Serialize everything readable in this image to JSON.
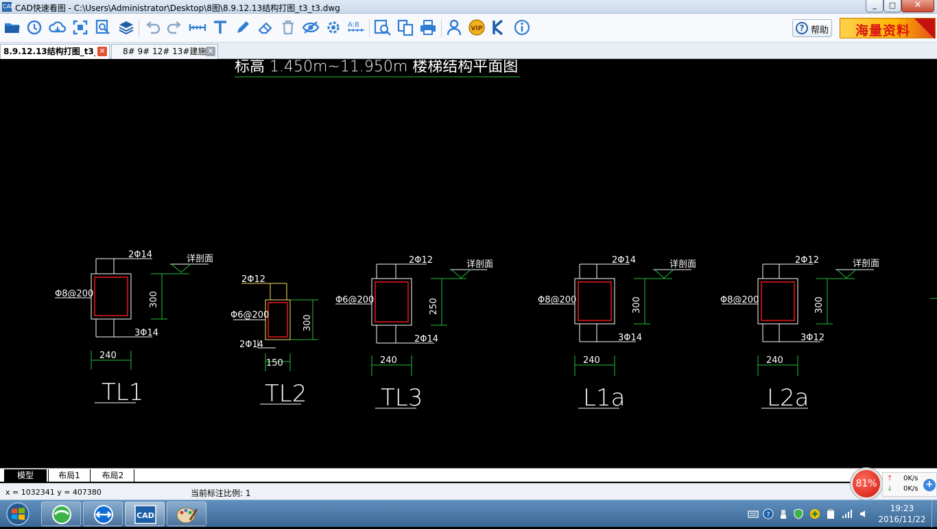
{
  "window": {
    "title": "CAD快速看图 - C:\\Users\\Administrator\\Desktop\\8图\\8.9.12.13结构打图_t3_t3.dwg",
    "app_icon_text": "CAD",
    "minimize": "_",
    "maximize": "□",
    "close": "✕"
  },
  "toolbar": {
    "icons": [
      "open-folder-icon",
      "history-icon",
      "cloud-icon",
      "fit-screen-icon",
      "zoom-window-icon",
      "layers-icon",
      "undo-icon",
      "redo-icon",
      "measure-icon",
      "text-icon",
      "pen-icon",
      "eraser-icon",
      "trash-icon",
      "hide-icon",
      "settings-icon",
      "scale-icon",
      "search-text-icon",
      "convert-icon",
      "print-icon",
      "user-icon",
      "vip-icon",
      "k-icon",
      "info-icon"
    ],
    "vip_label": "VIP",
    "scale_label": "A:B",
    "help_label": "帮助",
    "help_symbol": "?",
    "ad_text": "海量资料"
  },
  "tabs": [
    {
      "label": "8.9.12.13结构打图_t3_t3",
      "active": true
    },
    {
      "label": "8# 9# 12# 13#建施",
      "active": false
    }
  ],
  "tab_close_symbol": "✕",
  "drawing": {
    "header_text": "标高 1.450m~11.950m        楼梯结构平面图",
    "sections": [
      {
        "name": "TL1",
        "top_bar": "2Φ14",
        "bottom_bar": "3Φ14",
        "stirrup": "Φ8@200",
        "height": "300",
        "width": "240",
        "section_label": "详剖面"
      },
      {
        "name": "TL2",
        "top_bar": "2Φ12",
        "bottom_bar": "2Φ14",
        "stirrup": "Φ6@200",
        "height": "300",
        "width": "150",
        "section_label": ""
      },
      {
        "name": "TL3",
        "top_bar": "2Φ12",
        "bottom_bar": "2Φ14",
        "stirrup": "Φ6@200",
        "height": "250",
        "width": "240",
        "section_label": "详剖面"
      },
      {
        "name": "L1a",
        "top_bar": "2Φ14",
        "bottom_bar": "3Φ14",
        "stirrup": "Φ8@200",
        "height": "300",
        "width": "240",
        "section_label": "详剖面"
      },
      {
        "name": "L2a",
        "top_bar": "2Φ12",
        "bottom_bar": "3Φ12",
        "stirrup": "Φ8@200",
        "height": "300",
        "width": "240",
        "section_label": "详剖面"
      }
    ]
  },
  "layout_tabs": [
    "模型",
    "布局1",
    "布局2"
  ],
  "status": {
    "coords": "x = 1032341  y = 407380",
    "scale": "当前标注比例: 1"
  },
  "network": {
    "percent": "81%",
    "up": "0K/s",
    "down": "0K/s",
    "up_arrow": "↑",
    "down_arrow": "↓",
    "plus": "+"
  },
  "taskbar": {
    "apps": [
      "360-browser-icon",
      "teamviewer-icon",
      "cad-viewer-icon",
      "paint-icon"
    ],
    "cad_label": "CAD",
    "time": "19:23",
    "date": "2016/11/22"
  },
  "colors": {
    "dim_green": "#22c03a",
    "rebar_red": "#e01818",
    "outline_white": "#ffffff",
    "yellow_line": "#ffe26a"
  }
}
